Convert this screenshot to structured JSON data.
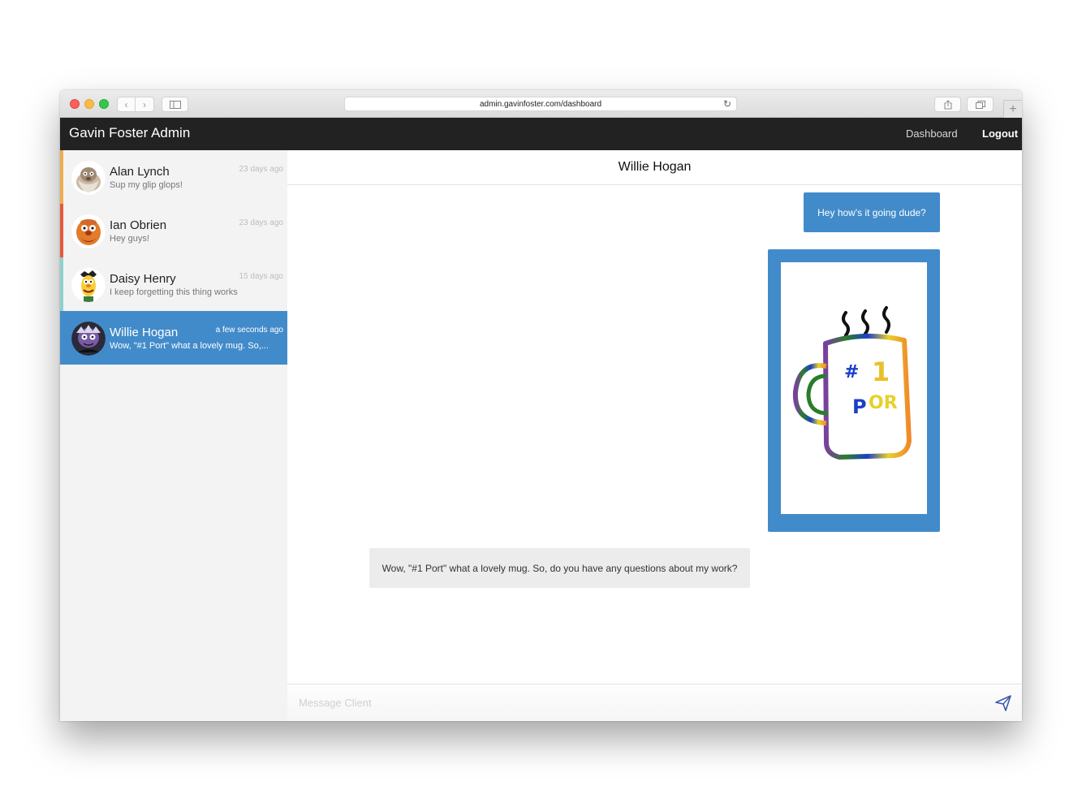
{
  "browser": {
    "url": "admin.gavinfoster.com/dashboard"
  },
  "navbar": {
    "brand": "Gavin Foster Admin",
    "dashboard_label": "Dashboard",
    "logout_label": "Logout"
  },
  "conversations": [
    {
      "name": "Alan Lynch",
      "preview": "Sup my glip glops!",
      "time": "23 days ago",
      "accent": "#f0ad4e"
    },
    {
      "name": "Ian Obrien",
      "preview": "Hey guys!",
      "time": "23 days ago",
      "accent": "#e9573f"
    },
    {
      "name": "Daisy Henry",
      "preview": "I keep forgetting this thing works",
      "time": "15 days ago",
      "accent": "#8fd0cf"
    },
    {
      "name": "Willie Hogan",
      "preview": "Wow, \"#1 Port\" what a lovely mug. So,...",
      "time": "a few seconds ago",
      "accent": "#428bca"
    }
  ],
  "chat": {
    "title": "Willie Hogan",
    "messages": [
      {
        "direction": "out",
        "text": "Hey how's it going dude?"
      },
      {
        "direction": "out",
        "type": "image",
        "caption": "#1 PORT"
      },
      {
        "direction": "in",
        "text": "Wow, \"#1 Port\" what a lovely mug. So, do you have any questions about my work?"
      }
    ],
    "composer_placeholder": "Message Client"
  },
  "colors": {
    "primary": "#428bca",
    "navbar": "#222222",
    "sidebar": "#f3f3f3"
  }
}
